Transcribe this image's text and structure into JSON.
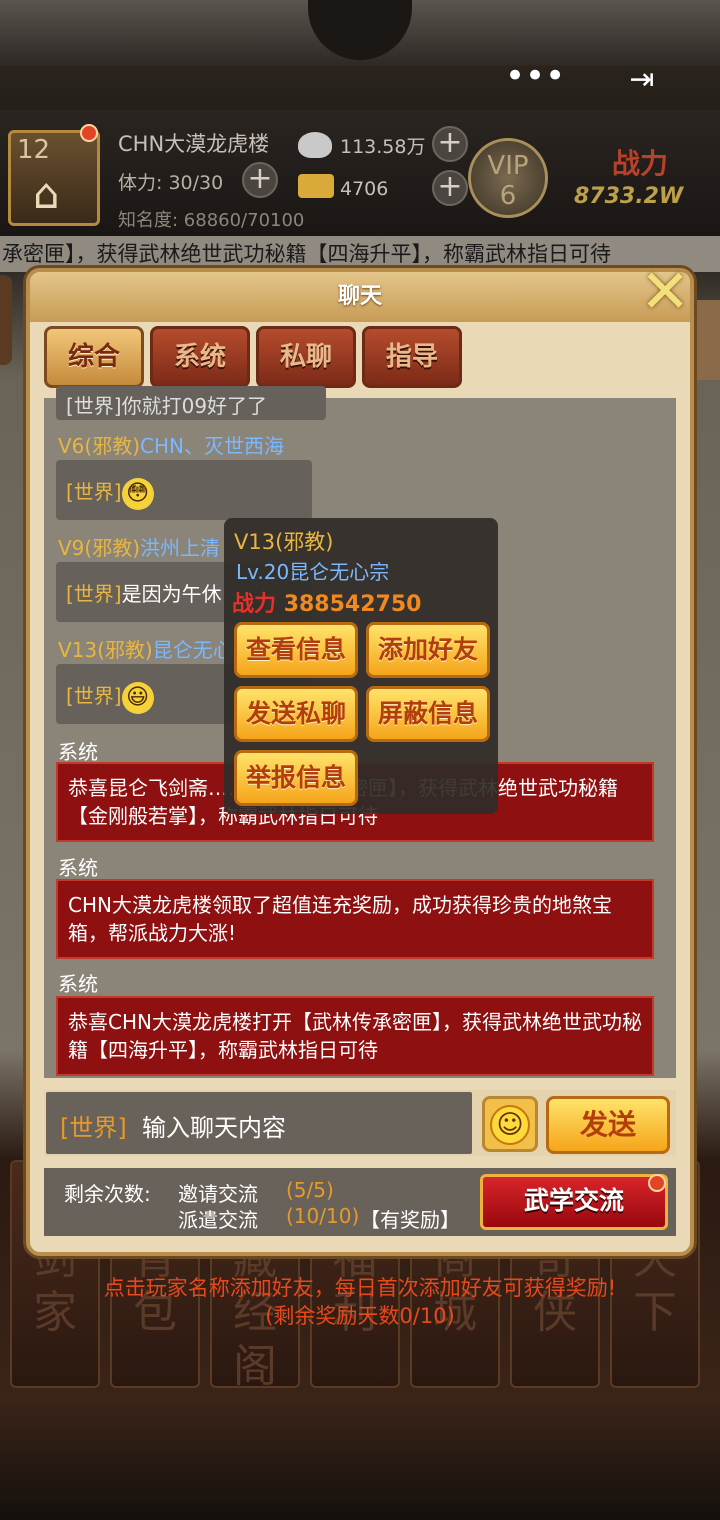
{
  "header": {
    "menu_label": "•••",
    "exit_label": "⇥"
  },
  "player": {
    "level": "12",
    "name": "CHN大漠龙虎楼",
    "stamina": "体力: 30/30",
    "fame": "知名度: 68860/70100",
    "silver": "113.58万",
    "gold": "4706",
    "vip": "VIP",
    "vip_level": "6",
    "power_label": "战力",
    "power_value": "8733.2W"
  },
  "marquee": "承密匣】，获得武林绝世武功秘籍【四海升平】，称霸武林指日可待",
  "panel": {
    "title": "聊天",
    "close": "✕"
  },
  "tabs": [
    {
      "label": "综合",
      "active": true
    },
    {
      "label": "系统",
      "active": false
    },
    {
      "label": "私聊",
      "active": false
    },
    {
      "label": "指导",
      "active": false
    }
  ],
  "chat": {
    "cut_top": "[世界]你就打09好了了",
    "messages": [
      {
        "vip": "V6(邪教)",
        "name": "CHN、灭世西海",
        "channel": "[世界]",
        "text": "",
        "emoji": "😳"
      },
      {
        "vip": "V9(邪教)",
        "name": "洪州上清",
        "channel": "[世界]",
        "text": "是因为午休",
        "emoji": ""
      },
      {
        "vip": "V13(邪教)",
        "name": "昆仑无心",
        "channel": "[世界]",
        "text": "",
        "emoji": "😃"
      }
    ],
    "system": [
      {
        "label": "系统",
        "text": "恭喜昆仑飞剑斋……【武林传承密匣】，获得武林绝世武功秘籍【金刚般若掌】，称霸武林指日可待"
      },
      {
        "label": "系统",
        "text": "CHN大漠龙虎楼领取了超值连充奖励，成功获得珍贵的地煞宝箱，帮派战力大涨!"
      },
      {
        "label": "系统",
        "text": "恭喜CHN大漠龙虎楼打开【武林传承密匣】，获得武林绝世武功秘籍【四海升平】，称霸武林指日可待"
      }
    ]
  },
  "popup": {
    "vip": "V13(邪教)",
    "sub": "Lv.20昆仑无心宗",
    "power_label": "战力",
    "power_value": "388542750",
    "buttons": [
      "查看信息",
      "添加好友",
      "发送私聊",
      "屏蔽信息",
      "举报信息"
    ]
  },
  "input": {
    "channel": "[世界]",
    "placeholder": "输入聊天内容",
    "send": "发送"
  },
  "quota": {
    "label": "剩余次数:",
    "invite_label": "邀请交流",
    "invite_value": "(5/5)",
    "dispatch_label": "派遣交流",
    "dispatch_value": "(10/10)",
    "reward": "【有奖励】",
    "button": "武学交流"
  },
  "hint": {
    "line1": "点击玩家名称添加好友，每日首次添加好友可获得奖励!",
    "line2": "(剩余奖励天数0/10)"
  },
  "bottom_nav": [
    "剑家",
    "背包",
    "藏经阁",
    "福利",
    "商城",
    "奇侠",
    "天下"
  ]
}
